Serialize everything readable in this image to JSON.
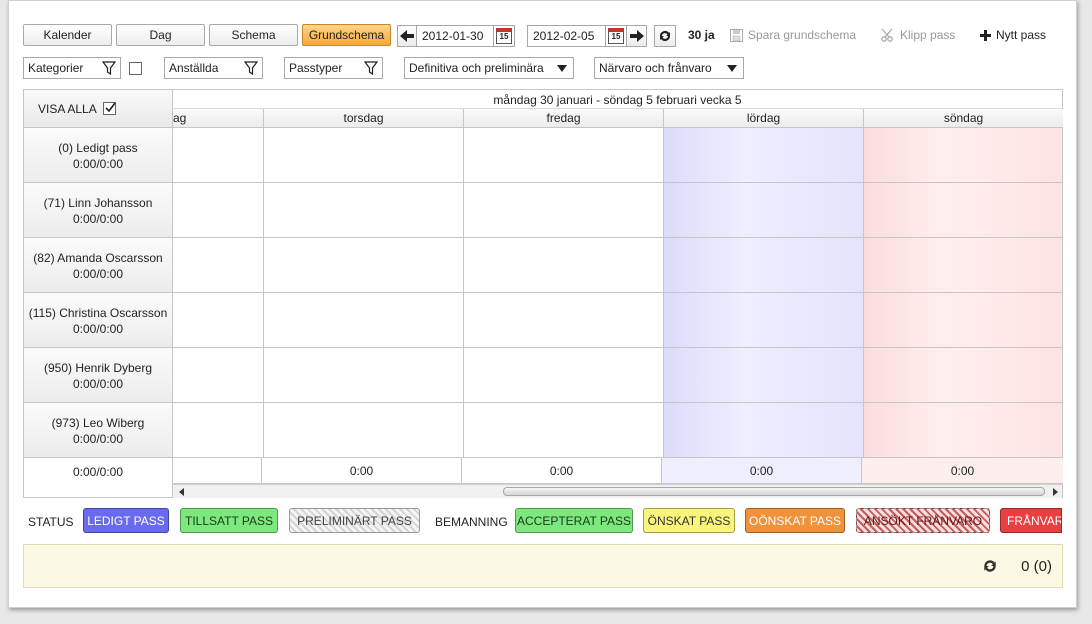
{
  "toolbar": {
    "views": [
      "Kalender",
      "Dag",
      "Schema",
      "Grundschema"
    ],
    "active_view": "Grundschema",
    "start_date": "2012-01-30",
    "end_date": "2012-02-05",
    "calendar_day": "15",
    "day_count": "30 ja",
    "save_label": "Spara grundschema",
    "cut_label": "Klipp pass",
    "new_label": "Nytt pass"
  },
  "filters": {
    "categories": "Kategorier",
    "employees": "Anställda",
    "shift_types": "Passtyper",
    "definitive": "Definitiva och preliminära",
    "presence": "Närvaro och frånvaro"
  },
  "grid": {
    "show_all": "VISA ALLA",
    "week_header": "måndag 30 januari  -  söndag 5 februari  vecka 5",
    "days": [
      "ag",
      "torsdag",
      "fredag",
      "lördag",
      "söndag"
    ],
    "employees": [
      {
        "name": "(0) Ledigt pass",
        "hours": "0:00/0:00"
      },
      {
        "name": "(71) Linn Johansson",
        "hours": "0:00/0:00"
      },
      {
        "name": "(82) Amanda Oscarsson",
        "hours": "0:00/0:00"
      },
      {
        "name": "(115) Christina Oscarsson",
        "hours": "0:00/0:00"
      },
      {
        "name": "(950) Henrik Dyberg",
        "hours": "0:00/0:00"
      },
      {
        "name": "(973) Leo Wiberg",
        "hours": "0:00/0:00"
      }
    ],
    "total_left": "0:00/0:00",
    "day_totals": [
      "",
      "0:00",
      "0:00",
      "0:00",
      "0:00"
    ]
  },
  "legend": {
    "status_label": "STATUS",
    "staffing_label": "BEMANNING",
    "items": [
      {
        "label": "LEDIGT PASS",
        "bg": "#6a6af0",
        "color": "#ffffff"
      },
      {
        "label": "TILLSATT PASS",
        "bg": "#7de87d",
        "color": "#1a3a1a"
      },
      {
        "label": "PRELIMINÄRT PASS",
        "bg": "#e6e6e6",
        "color": "#444444"
      },
      {
        "label": "ACCEPTERAT PASS",
        "bg": "#7de87d",
        "color": "#1a3a1a"
      },
      {
        "label": "ÖNSKAT PASS",
        "bg": "#fbf47a",
        "color": "#333333"
      },
      {
        "label": "OÖNSKAT PASS",
        "bg": "#f0923a",
        "color": "#ffffff"
      },
      {
        "label": "ANSÖKT FRÅNVARO",
        "bg": "#e88f8f",
        "color": "#5a1a1a"
      },
      {
        "label": "FRÅNVARO",
        "bg": "#e84040",
        "color": "#ffffff"
      }
    ]
  },
  "footer": {
    "count": "0 (0)"
  }
}
